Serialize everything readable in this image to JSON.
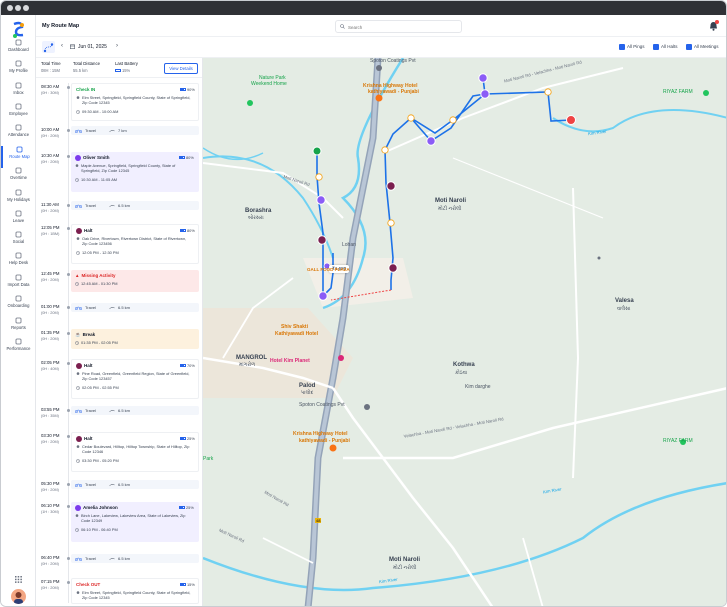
{
  "app": {
    "page_title": "My Route Map",
    "search_placeholder": "Search"
  },
  "sidebar": {
    "items": [
      {
        "label": "Dashboard",
        "icon": "dashboard-icon"
      },
      {
        "label": "My Profile",
        "icon": "user-icon"
      },
      {
        "label": "Inbox",
        "icon": "inbox-icon"
      },
      {
        "label": "Employee",
        "icon": "employee-icon"
      },
      {
        "label": "Attendance",
        "icon": "calendar-icon"
      },
      {
        "label": "Route Map",
        "icon": "map-icon"
      },
      {
        "label": "Overtime",
        "icon": "clock-icon"
      },
      {
        "label": "My Holidays",
        "icon": "holiday-icon"
      },
      {
        "label": "Leave",
        "icon": "leave-icon"
      },
      {
        "label": "Social",
        "icon": "social-icon"
      },
      {
        "label": "Help Desk",
        "icon": "helpdesk-icon"
      },
      {
        "label": "Import Data",
        "icon": "import-icon"
      },
      {
        "label": "Onboarding",
        "icon": "onboarding-icon"
      },
      {
        "label": "Reports",
        "icon": "reports-icon"
      },
      {
        "label": "Performance",
        "icon": "performance-icon"
      }
    ],
    "active": "Route Map"
  },
  "toolbar": {
    "date": "Jun 01, 2025",
    "filters": [
      {
        "label": "All Pings",
        "checked": true
      },
      {
        "label": "All Halts",
        "checked": true
      },
      {
        "label": "All Meetings",
        "checked": true
      }
    ]
  },
  "stats": {
    "total_time_label": "Total Time",
    "total_time_value": "08H : 15M",
    "total_distance_label": "Total Distance",
    "total_distance_value": "55.5 km",
    "last_battery_label": "Last Battery",
    "last_battery_value": "15%",
    "view_details": "View Details"
  },
  "timeline": [
    {
      "time": "08:30 AM",
      "dur": "(0H : 30M)",
      "kind": "checkin",
      "title": "Check IN",
      "battery": "90%",
      "address": "Elm Street, Springfield, Springfield County, State of Springfield, Zip Code 12345",
      "range": "09:30 AM   -   10:00 AM"
    },
    {
      "time": "10:00 AM",
      "dur": "(0H : 20M)",
      "kind": "travel",
      "label": "Travel",
      "distance": "7 km"
    },
    {
      "time": "10:30 AM",
      "dur": "(0H : 20M)",
      "kind": "meeting",
      "title": "Oliver Smith",
      "battery": "80%",
      "address": "Maple Avenue, Springfield, Springfield County, State of Springfield, Zip Code 12345",
      "range": "10:30 AM   -   11:05 AM"
    },
    {
      "time": "11:30 AM",
      "dur": "(0H : 20M)",
      "kind": "travel",
      "label": "Travel",
      "distance": "6.5 km"
    },
    {
      "time": "12:05 PM",
      "dur": "(0H : 1BM)",
      "kind": "halt",
      "title": "Halt",
      "battery": "80%",
      "address": "Oak Drive, Rivertown, Rivertown District, State of Rivertown, Zip Code 123456",
      "range": "12:05 PM   -   12:30 PM"
    },
    {
      "time": "12:45 PM",
      "dur": "(0H : 20M)",
      "kind": "missing",
      "title": "Missing Activity",
      "range": "12:45 AM   -   01:30 PM"
    },
    {
      "time": "01:00 PM",
      "dur": "(0H : 20M)",
      "kind": "travel",
      "label": "Travel",
      "distance": "6.5 km"
    },
    {
      "time": "01:35 PM",
      "dur": "(0H : 20M)",
      "kind": "break",
      "title": "Break",
      "range": "01:35 PM   -   02:05 PM"
    },
    {
      "time": "02:05 PM",
      "dur": "(0H : 40M)",
      "kind": "halt",
      "title": "Halt",
      "battery": "70%",
      "address": "Pine Road, Greenfield, Greenfield Region, State of Greenfield, Zip Code 123457",
      "range": "02:05 PM   -   02:55 PM"
    },
    {
      "time": "03:55 PM",
      "dur": "(0H : 35M)",
      "kind": "travel",
      "label": "Travel",
      "distance": "6.5 km"
    },
    {
      "time": "03:30 PM",
      "dur": "(0H : 20M)",
      "kind": "halt",
      "title": "Halt",
      "battery": "25%",
      "address": "Cedar Boulevard, Hilltop, Hilltop Township, State of Hilltop, Zip Code 12346",
      "range": "03:30 PM   -   05:20 PM"
    },
    {
      "time": "05:30 PM",
      "dur": "(0H : 20M)",
      "kind": "travel",
      "label": "Travel",
      "distance": "6.5 km"
    },
    {
      "time": "06:10 PM",
      "dur": "(1H : 30M)",
      "kind": "meeting",
      "title": "Amelia Johnson",
      "battery": "25%",
      "address": "Birch Lane, Lakeview, Lakeview Area, State of Lakeview, Zip Code 12349",
      "range": "06:10 PM   -   06:40 PM"
    },
    {
      "time": "06:40 PM",
      "dur": "(0H : 20M)",
      "kind": "travel",
      "label": "Travel",
      "distance": "6.5 km"
    },
    {
      "time": "07:15 PM",
      "dur": "(0H : 20M)",
      "kind": "checkout",
      "title": "Check OUT",
      "battery": "15%",
      "address": "Elm Street, Springfield, Springfield County, State of Springfield, Zip Code 12345",
      "range": ""
    }
  ],
  "map": {
    "labels": {
      "spoton_top": "Spoton Coatings Pvt",
      "krishna_top": "Krishna Highway Hotel",
      "krishna_top_sub": "kathiyawadi - Punjabi",
      "nature_park": "Nature Park",
      "weekend_home": "Weekend Home",
      "moti_naroli_rd_top": "Moti Naroli Rd - Velachha - Moti Naroli Rd",
      "riyaz_farm_top": "RIYAZ FARM",
      "kim_river_top": "Kim River",
      "moti_rd_left": "Moti Naroli Rd",
      "borashra": "Borashra",
      "borashra_gu": "બોરસરા",
      "moti_naroli": "Moti Naroli",
      "moti_naroli_gu": "મોટી નરોલી",
      "lohan": "Lohan",
      "price": "₹1,680",
      "gall_food": "GALL FOOD PLAZA",
      "valesa": "Valesa",
      "valesa_gu": "વાલેસા",
      "shiv_shakti": "Shiv Shakti",
      "shiv_shakti_sub": "Kathiyawadi Hotel",
      "hotel_kim": "Hotel Kim Planet",
      "mangrol": "MANGROL",
      "mangrol_gu": "માંગરોળ",
      "kothwa": "Kothwa",
      "kothwa_gu": "કોઠવા",
      "kim_darghe": "Kim darghe",
      "palod": "Palod",
      "palod_gu": "પાલોદ",
      "spoton_mid": "Spoton Coatings Pvt",
      "krishna_mid": "Krishna Highway Hotel",
      "krishna_mid_sub": "kathiyawadi - Punjabi",
      "velachha_rd": "Velachha - Moti Naroli Rd - Velachha - Moti Naroli Rd",
      "riyaz_farm_mid": "RIYAZ FARM",
      "park": "Park",
      "moti_rd_mid": "Moti Naroli Rd",
      "kim_river_mid": "Kim River",
      "moti_naroli_bottom": "Moti Naroli",
      "moti_naroli_bottom_gu": "મોટી નરોલી",
      "kim_river_bottom": "Kim River",
      "moti_rd_bottom": "Moti Naroli Rd",
      "road_48": "48"
    }
  },
  "colors": {
    "accent": "#2563eb",
    "meeting": "#7c3aed",
    "halt": "#7b1f4f",
    "checkin": "#16a34a",
    "checkout": "#dc2626",
    "route_blue": "#1d72e8",
    "missing_red": "#ef4444"
  }
}
